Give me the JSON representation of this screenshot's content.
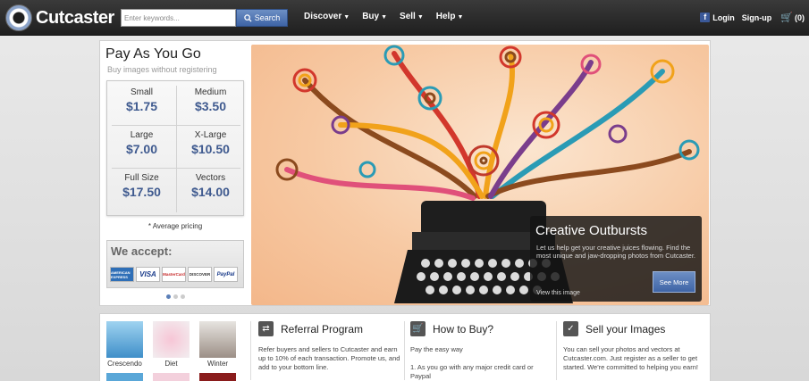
{
  "header": {
    "brand": "Cutcaster",
    "search_placeholder": "Enter keywords...",
    "search_button": "Search",
    "nav": [
      "Discover",
      "Buy",
      "Sell",
      "Help"
    ],
    "login": "Login",
    "signup": "Sign-up",
    "cart": "(0)"
  },
  "pricing": {
    "title": "Pay As You Go",
    "subtitle": "Buy images without registering",
    "sizes": [
      {
        "label": "Small",
        "price": "$1.75"
      },
      {
        "label": "Medium",
        "price": "$3.50"
      },
      {
        "label": "Large",
        "price": "$7.00"
      },
      {
        "label": "X-Large",
        "price": "$10.50"
      },
      {
        "label": "Full Size",
        "price": "$17.50"
      },
      {
        "label": "Vectors",
        "price": "$14.00"
      }
    ],
    "note": "* Average pricing",
    "accept_title": "We accept:",
    "cards": [
      "AMERICAN EXPRESS",
      "VISA",
      "MasterCard",
      "DISCOVER",
      "PayPal"
    ]
  },
  "hero": {
    "title": "Creative Outbursts",
    "text": "Let us help get your creative juices flowing. Find the most unique and jaw-dropping photos from Cutcaster.",
    "view_link": "View this image",
    "see_more": "See More"
  },
  "thumbnails": [
    {
      "caption": "Crescendo"
    },
    {
      "caption": "Diet"
    },
    {
      "caption": "Winter"
    }
  ],
  "info": [
    {
      "title": "Referral Program",
      "text": "Refer buyers and sellers to Cutcaster and earn up to 10% of each transaction. Promote us, and add to your bottom line."
    },
    {
      "title": "How to Buy?",
      "text": "Pay the easy way\n\n1. As you go with any major credit card or Paypal"
    },
    {
      "title": "Sell your Images",
      "text": "You can sell your photos and vectors at Cutcaster.com. Just register as a seller to get started. We're committed to helping you earn!"
    }
  ],
  "colors": {
    "accent": "#3e64a6",
    "price": "#3f5a8f"
  }
}
